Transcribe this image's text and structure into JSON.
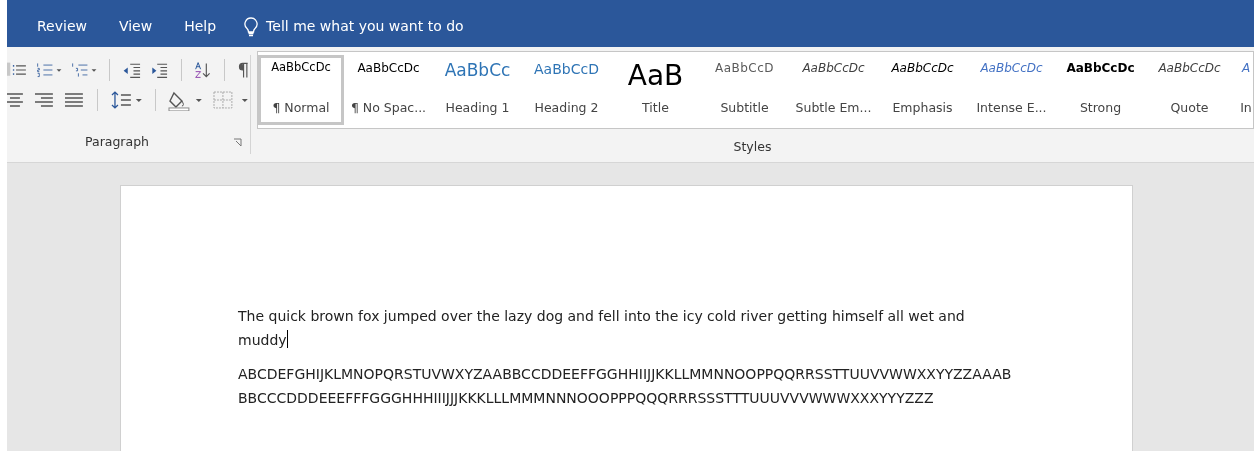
{
  "menu_tabs": [
    {
      "label": "Review"
    },
    {
      "label": "View"
    },
    {
      "label": "Help"
    }
  ],
  "tell_me": {
    "placeholder": "Tell me what you want to do"
  },
  "paragraph_group": {
    "label": "Paragraph",
    "rows": [
      [
        {
          "kind": "bullets"
        },
        {
          "kind": "numbering"
        },
        {
          "kind": "multilevel"
        },
        {
          "kind": "sep"
        },
        {
          "kind": "outdent"
        },
        {
          "kind": "indent"
        },
        {
          "kind": "sep"
        },
        {
          "kind": "sort"
        },
        {
          "kind": "sep"
        },
        {
          "kind": "pilcrow"
        }
      ],
      [
        {
          "kind": "align-center"
        },
        {
          "kind": "align-right"
        },
        {
          "kind": "justify"
        },
        {
          "kind": "sep"
        },
        {
          "kind": "line-spacing"
        },
        {
          "kind": "sep"
        },
        {
          "kind": "shading"
        },
        {
          "kind": "borders"
        }
      ]
    ]
  },
  "styles_group": {
    "label": "Styles",
    "items": [
      {
        "preview": "AaBbCcDc",
        "label": "¶ Normal",
        "kind": "normal",
        "selected": true
      },
      {
        "preview": "AaBbCcDc",
        "label": "¶ No Spac...",
        "kind": "normal",
        "selected": false
      },
      {
        "preview": "AaBbCc",
        "label": "Heading 1",
        "kind": "heading1",
        "selected": false
      },
      {
        "preview": "AaBbCcD",
        "label": "Heading 2",
        "kind": "heading2",
        "selected": false
      },
      {
        "preview": "AaB",
        "label": "Title",
        "kind": "title",
        "selected": false
      },
      {
        "preview": "AaBbCcD",
        "label": "Subtitle",
        "kind": "subtitle",
        "selected": false
      },
      {
        "preview": "AaBbCcDc",
        "label": "Subtle Em...",
        "kind": "subtle",
        "selected": false
      },
      {
        "preview": "AaBbCcDc",
        "label": "Emphasis",
        "kind": "emphasis",
        "selected": false
      },
      {
        "preview": "AaBbCcDc",
        "label": "Intense E...",
        "kind": "intense",
        "selected": false
      },
      {
        "preview": "AaBbCcDc",
        "label": "Strong",
        "kind": "strong",
        "selected": false
      },
      {
        "preview": "AaBbCcDc",
        "label": "Quote",
        "kind": "quote",
        "selected": false
      },
      {
        "preview": "A",
        "label": "In",
        "kind": "intense",
        "selected": false
      }
    ]
  },
  "document": {
    "paragraphs": [
      {
        "text": "The quick brown fox jumped over the lazy dog and fell into the icy cold river getting himself all wet and muddy",
        "cursor": true
      },
      {
        "text": "ABCDEFGHIJKLMNOPQRSTUVWXYZAABBCCDDEEFFGGHHIIJJKKLLMMNNOOPPQQRRSSTTUUVVWWXXYYZZAAABBBCCCDDDEEEFFFGGGHHHIIIJJJKKKLLLMMMNNNOOOPPPQQQRRRSSSTTTUUUVVVWWWXXXYYYZZZ",
        "cursor": false
      }
    ]
  }
}
